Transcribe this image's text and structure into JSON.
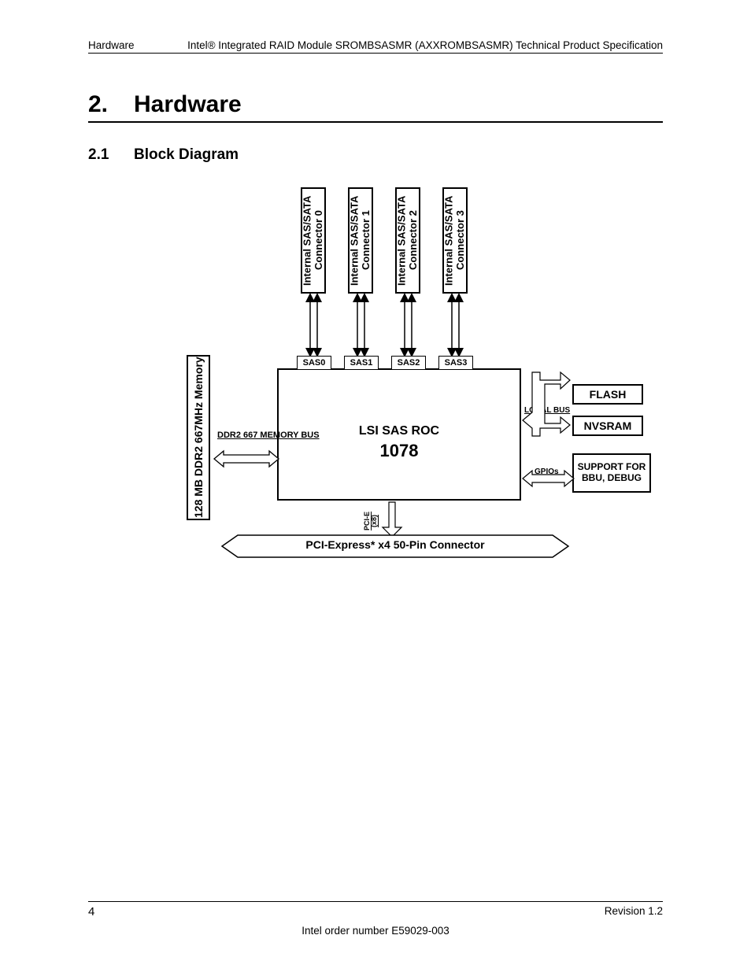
{
  "header": {
    "left": "Hardware",
    "right": "Intel® Integrated RAID Module SROMBSASMR (AXXROMBSASMR) Technical Product Specification"
  },
  "chapter": {
    "num": "2.",
    "text": "Hardware"
  },
  "section": {
    "num": "2.1",
    "text": "Block Diagram"
  },
  "diagram": {
    "conn": [
      "Internal SAS/SATA Connector 0",
      "Internal SAS/SATA Connector 1",
      "Internal SAS/SATA Connector 2",
      "Internal SAS/SATA Connector 3"
    ],
    "sas": [
      "SAS0",
      "SAS1",
      "SAS2",
      "SAS3"
    ],
    "memory": "128 MB DDR2 667MHz Memory",
    "mem_bus": "DDR2 667 MEMORY BUS",
    "roc_top": "LSI SAS ROC",
    "roc_num": "1078",
    "local_bus": "LOCAL BUS",
    "gpios": "GPIOs",
    "flash": "FLASH",
    "nvsram": "NVSRAM",
    "support": "SUPPORT FOR BBU, DEBUG",
    "pcie_small": "PCI-E (x8)",
    "pcie": "PCI-Express* x4 50-Pin Connector"
  },
  "footer": {
    "page": "4",
    "revision": "Revision 1.2",
    "order": "Intel order number E59029-003"
  }
}
